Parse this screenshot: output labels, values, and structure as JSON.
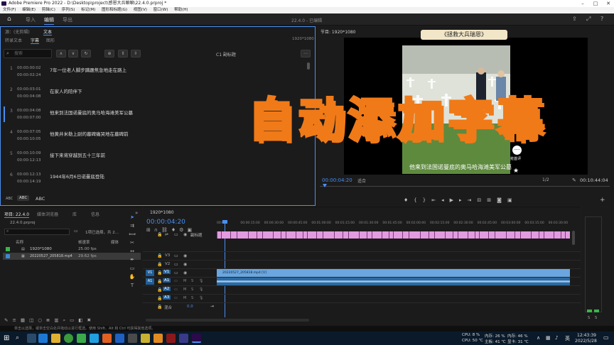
{
  "window": {
    "title": "Adobe Premiere Pro 2022 - D:\\Desktop\\project\\感恩大兵嘛嘛\\22.4.0.prproj *"
  },
  "menu": [
    "文件(F)",
    "编辑(E)",
    "剪辑(C)",
    "序列(S)",
    "标记(M)",
    "图形和标题(G)",
    "视图(V)",
    "窗口(W)",
    "帮助(H)"
  ],
  "workspace": {
    "tabs": [
      "导入",
      "编辑",
      "导出"
    ],
    "active": "编辑",
    "center_label": "22.4.0 - 已编辑"
  },
  "text_panel": {
    "header_tabs": [
      "源：(无剪辑)",
      "文本"
    ],
    "sub_tabs": [
      "转录文本",
      "字幕",
      "图形"
    ],
    "active_sub_tab": "字幕",
    "sequence_size": "1920*1080",
    "search_placeholder": "搜索",
    "track_label": "C1 副标题",
    "captions": [
      {
        "num": "1",
        "in": "00:00:00:02",
        "out": "00:00:02:24",
        "text": "7年一位老人脚步蹒跚焦急地走在路上"
      },
      {
        "num": "2",
        "in": "00:00:03:01",
        "out": "00:00:04:08",
        "text": "在家人的陪伴下"
      },
      {
        "num": "3",
        "in": "00:00:04:08",
        "out": "00:00:07:00",
        "text": "他来到法国诺曼底的奥马哈海滩美军公墓"
      },
      {
        "num": "4",
        "in": "00:00:07:05",
        "out": "00:00:10:05",
        "text": "他黄井米勒上尉的墓碑痛哭地在墓碑前"
      },
      {
        "num": "5",
        "in": "00:00:10:09",
        "out": "00:00:12:13",
        "text": "接下来将穿越到五十三年前"
      },
      {
        "num": "6",
        "in": "00:00:12:13",
        "out": "00:00:14:19",
        "text": "1944年6月6日诺曼底登陆"
      }
    ],
    "bottom_buttons": [
      "ABC",
      "ABC",
      "ABC"
    ]
  },
  "program": {
    "title": "节目: 1920*1080",
    "top_caption": "《拯救大兵瑞恩》",
    "overlay_text": "自动添加字幕",
    "subtitle": "他来到法国诺曼底的奥马哈海滩美军公墓",
    "comment_label": "抢首评",
    "timecode": "00:00:04:20",
    "fit": "适合",
    "quality": "1/2",
    "duration": "00:10:44:04"
  },
  "project": {
    "tabs": [
      "项目: 22.4.0",
      "媒体浏览器",
      "库",
      "信息"
    ],
    "file": "22.4.0.prproj",
    "selection_info": "1项已选择，共 2...",
    "columns": [
      "名称",
      "帧速率",
      "媒体"
    ],
    "items": [
      {
        "name": "1920*1080",
        "fps": "25.00 fps",
        "color": "#3bb54a"
      },
      {
        "name": "20220527_205818.mp4",
        "fps": "29.62 fps",
        "color": "#3a8ad0"
      }
    ]
  },
  "timeline": {
    "tab": "1920*1080",
    "timecode": "00:00:04:20",
    "ruler": [
      "00:00",
      "00:00:15:00",
      "00:00:30:00",
      "00:00:45:00",
      "00:01:00:00",
      "00:01:15:00",
      "00:01:30:00",
      "00:01:45:00",
      "00:02:00:00",
      "00:02:15:00",
      "00:02:30:00",
      "00:02:45:00",
      "00:03:00:00",
      "00:03:15:00",
      "00:03:30:00"
    ],
    "subtitle_track": "副标题",
    "video_tracks": [
      "V3",
      "V2",
      "V1"
    ],
    "audio_tracks": [
      "A1",
      "A2",
      "A3"
    ],
    "master": "混合",
    "master_value": "0.0",
    "clip_name": "20220527_205818.mp4 [V]"
  },
  "meters": {
    "labels": [
      "S",
      "S"
    ]
  },
  "status": {
    "hint": "单击以选择，或单击空白处并拖动以进行框选。使用 Shift、Alt 和 Ctrl 可获得其他选项。"
  },
  "taskbar": {
    "cpu": "CPU: 8 %",
    "cpu_temp": "CPU: 50 ℃",
    "mem": "内存: 26 %",
    "board": "主板: 41 ℃",
    "disk": "内存: 46 %",
    "gpu": "显卡: 31 ℃",
    "lang": "英",
    "time": "12:43:39",
    "date": "2022/5/28"
  }
}
